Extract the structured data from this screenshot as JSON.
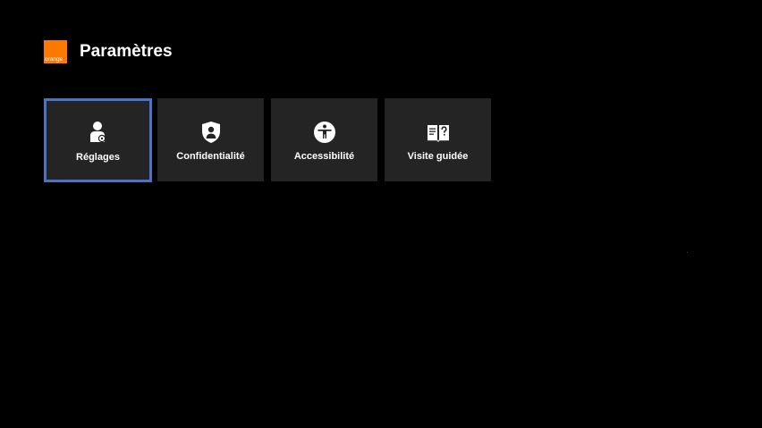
{
  "header": {
    "logo_text": "orange",
    "title": "Paramètres"
  },
  "colors": {
    "brand": "#ff7900",
    "focus": "#4a73c6",
    "tile_bg": "#242424",
    "background": "#000000"
  },
  "tiles": [
    {
      "label": "Réglages",
      "icon": "user-gear-icon",
      "focused": true
    },
    {
      "label": "Confidentialité",
      "icon": "shield-user-icon",
      "focused": false
    },
    {
      "label": "Accessibilité",
      "icon": "accessibility-icon",
      "focused": false
    },
    {
      "label": "Visite guidée",
      "icon": "guide-book-question-icon",
      "focused": false
    }
  ]
}
